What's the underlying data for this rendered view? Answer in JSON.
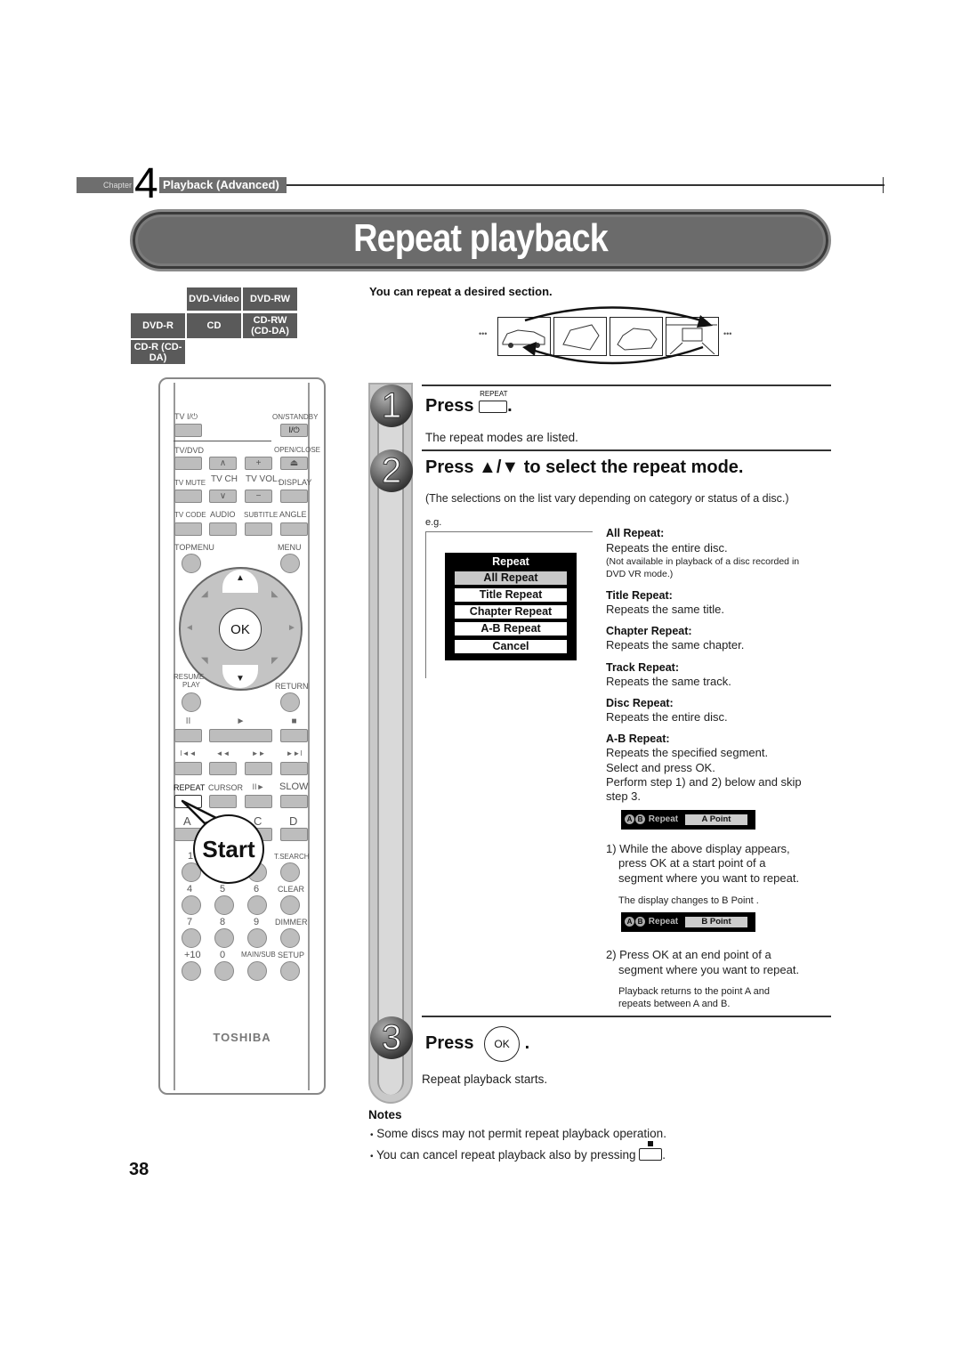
{
  "chapter": {
    "word": "Chapter",
    "number": "4",
    "title": "Playback (Advanced)"
  },
  "title": "Repeat playback",
  "disc_badges": [
    "DVD-Video",
    "DVD-RW",
    "DVD-R",
    "CD",
    "CD-RW (CD-DA)",
    "CD-R (CD-DA)"
  ],
  "remote": {
    "labels": {
      "tv_power": "TV I/⏻",
      "on_standby": "ON/STANDBY",
      "on_standby_sym": "I/⏻",
      "tv_dvd": "TV/DVD",
      "open_close": "OPEN/CLOSE",
      "tv_mute": "TV MUTE",
      "tv_ch": "TV CH",
      "tv_vol": "TV VOL.",
      "display": "DISPLAY",
      "tv_code": "TV CODE",
      "audio": "AUDIO",
      "subtitle": "SUBTITLE",
      "angle": "ANGLE",
      "topmenu": "TOPMENU",
      "menu": "MENU",
      "ok": "OK",
      "resume": "RESUME",
      "play": "PLAY",
      "return": "RETURN",
      "repeat": "REPEAT",
      "cursor": "CURSOR",
      "slow": "SLOW",
      "a": "A",
      "c": "C",
      "d": "D",
      "one": "1",
      "t_search": "T.SEARCH",
      "four": "4",
      "five": "5",
      "six": "6",
      "clear": "CLEAR",
      "seven": "7",
      "eight": "8",
      "nine": "9",
      "dimmer": "DIMMER",
      "plus10": "+10",
      "zero": "0",
      "main_sub": "MAIN/SUB",
      "setup": "SETUP"
    },
    "symbols": {
      "ch_up": "∧",
      "ch_down": "∨",
      "vol_up": "+",
      "vol_down": "−",
      "eject": "⏏",
      "pause": "II",
      "play": "►",
      "stop": "■",
      "skip_back": "I◄◄",
      "rewind": "◄◄",
      "fast_forward": "►►",
      "skip_forward": "►►I",
      "frame_advance": "II►",
      "up": "▲",
      "down": "▼",
      "left": "◄",
      "right": "►"
    },
    "brand": "TOSHIBA",
    "callout": "Start"
  },
  "intro": "You can repeat a desired section.",
  "ellipsis": "•••",
  "steps": [
    {
      "number": "1",
      "press": "Press",
      "key_label": "REPEAT",
      "suffix": ".",
      "body": "The repeat modes are listed."
    },
    {
      "number": "2",
      "heading": "Press ▲/▼ to select the repeat mode.",
      "body": "(The selections on the list vary depending on category or status of a disc.)",
      "eg": "e.g."
    },
    {
      "number": "3",
      "press": "Press",
      "key_label": "OK",
      "suffix": ".",
      "body": "Repeat playback starts."
    }
  ],
  "menu": {
    "title": "Repeat",
    "items": [
      "All Repeat",
      "Title Repeat",
      "Chapter Repeat",
      "A-B Repeat",
      "Cancel"
    ],
    "selected": "All Repeat"
  },
  "modes": [
    {
      "term": "All Repeat:",
      "desc": "Repeats the entire disc.",
      "note": "(Not available in playback of a disc recorded in DVD VR mode.)"
    },
    {
      "term": "Title Repeat:",
      "desc": "Repeats the same title."
    },
    {
      "term": "Chapter Repeat:",
      "desc": "Repeats the same chapter."
    },
    {
      "term": "Track Repeat:",
      "desc": "Repeats the same track."
    },
    {
      "term": "Disc Repeat:",
      "desc": "Repeats the entire disc."
    },
    {
      "term": "A-B Repeat:",
      "desc": [
        "Repeats the specified segment.",
        "Select and press OK.",
        "Perform step 1) and 2) below and skip",
        "step 3."
      ]
    }
  ],
  "ab": {
    "osd_label": "Repeat",
    "a_letter": "A",
    "b_letter": "B",
    "osd_a": "A Point",
    "osd_b": "B Point",
    "step1": [
      "1) While the above display appears,",
      "press OK at a start point of a",
      "segment where you want to repeat."
    ],
    "step1_note": "The display changes to  B Point .",
    "step2": [
      "2) Press OK at an end point of a",
      "segment where you want to repeat."
    ],
    "step2_note": [
      "Playback returns to the point A and",
      "repeats between A and B."
    ]
  },
  "notes": {
    "heading": "Notes",
    "items": [
      "Some discs may not permit repeat playback operation.",
      "You can cancel repeat playback also by pressing"
    ],
    "bullet": "•"
  },
  "page_number": "38"
}
